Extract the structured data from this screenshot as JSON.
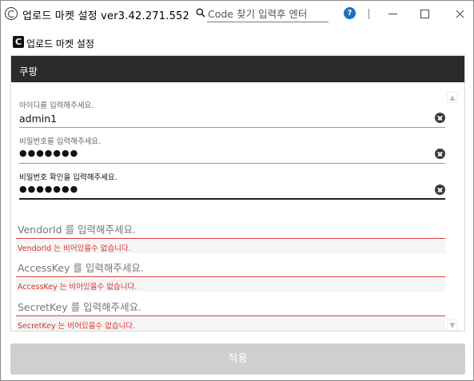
{
  "window": {
    "title": "업로드 마켓 설정 ver3.42.271.552",
    "search_placeholder": "Code 찾기 입력후 엔터",
    "help_label": "?"
  },
  "header": {
    "logo_letter": "C",
    "title": "업로드 마켓 설정"
  },
  "panel": {
    "title": "쿠팡",
    "fields": [
      {
        "label": "아이디를 입력해주세요.",
        "value": "admin1"
      },
      {
        "label": "비밀번호를 입력해주세요.",
        "value": "●●●●●●●"
      },
      {
        "label": "비밀번호 확인을 입력해주세요.",
        "value": "●●●●●●●"
      }
    ],
    "required_fields": [
      {
        "placeholder": "VendorId 를 입력해주세요.",
        "error": "VendorId 는 비어있을수 없습니다."
      },
      {
        "placeholder": "AccessKey 를 입력해주세요.",
        "error": "AccessKey 는 비어있을수 없습니다."
      },
      {
        "placeholder": "SecretKey 를 입력해주세요.",
        "error": "SecretKey 는 비어있을수 없습니다."
      }
    ]
  },
  "footer": {
    "apply_label": "적용"
  },
  "colors": {
    "panel_header_bg": "#2b2b2b",
    "error_red": "#d9322e",
    "help_blue": "#1f6fbf",
    "apply_disabled": "#cfcfcf"
  }
}
